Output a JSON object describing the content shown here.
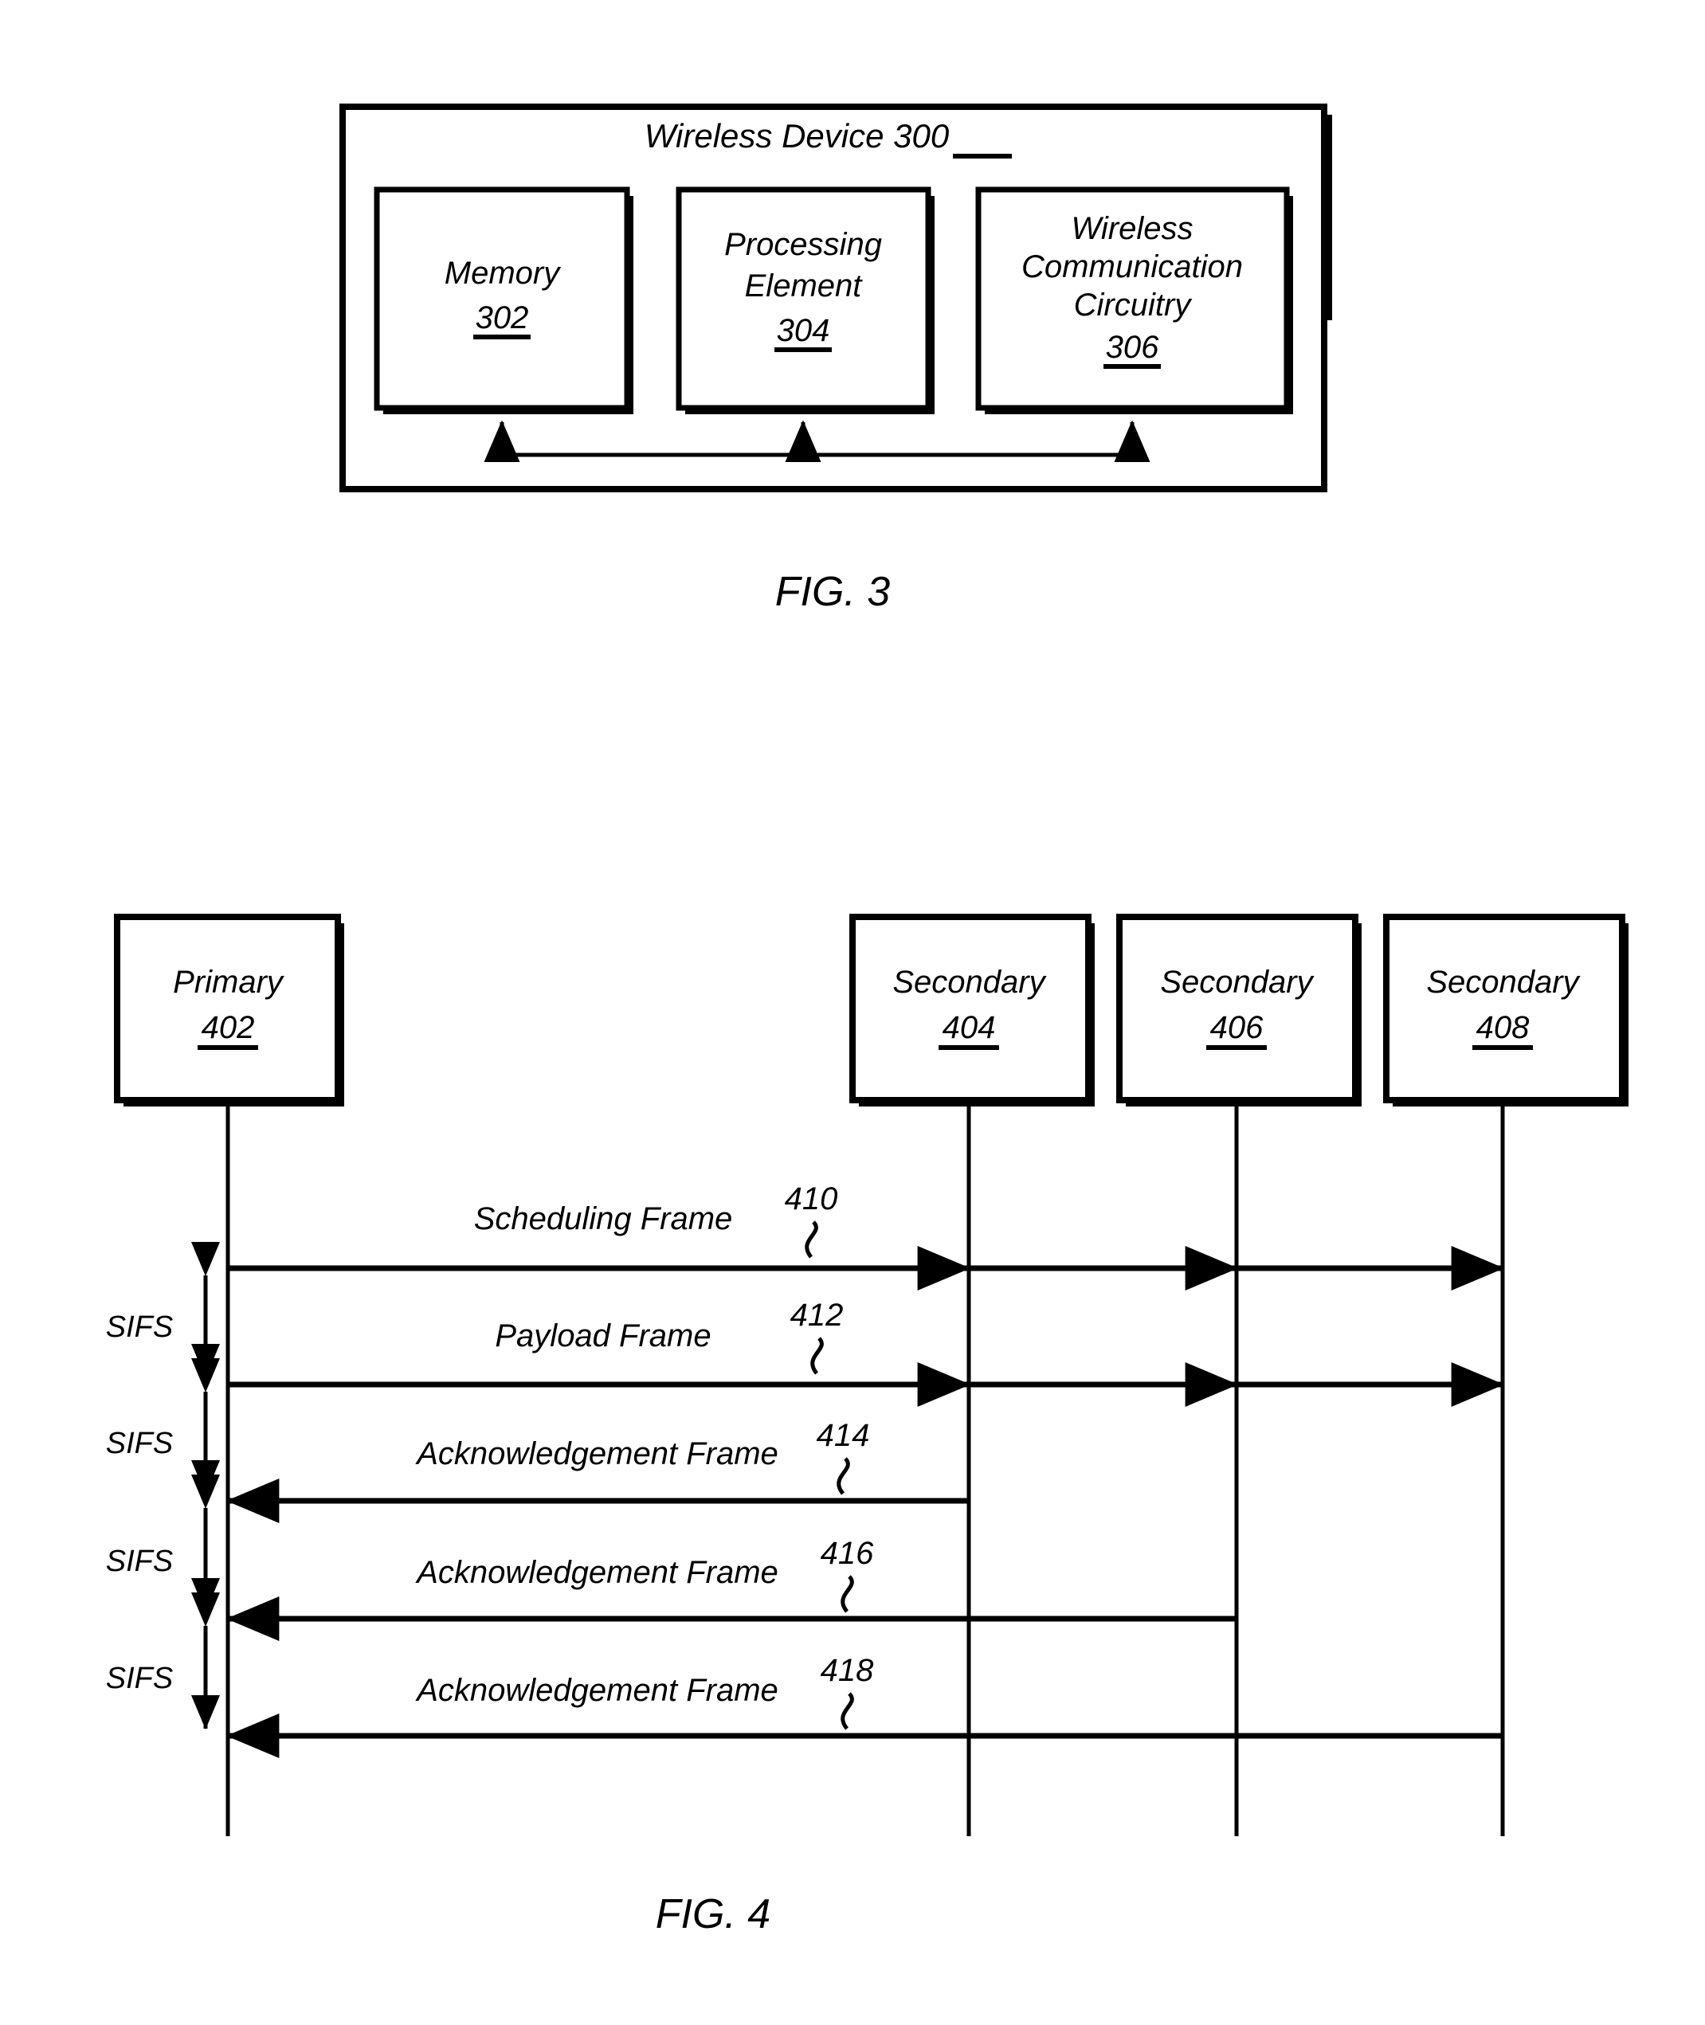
{
  "figure3": {
    "caption": "FIG. 3",
    "device": {
      "title": "Wireless Device",
      "ref": "300"
    },
    "blocks": [
      {
        "name": "Memory",
        "lines": [
          "Memory"
        ],
        "ref": "302"
      },
      {
        "name": "Processing Element",
        "lines": [
          "Processing",
          "Element"
        ],
        "ref": "304"
      },
      {
        "name": "Wireless Communication Circuitry",
        "lines": [
          "Wireless",
          "Communication",
          "Circuitry"
        ],
        "ref": "306"
      }
    ]
  },
  "figure4": {
    "caption": "FIG. 4",
    "nodes": [
      {
        "name": "Primary",
        "ref": "402"
      },
      {
        "name": "Secondary",
        "ref": "404"
      },
      {
        "name": "Secondary",
        "ref": "406"
      },
      {
        "name": "Secondary",
        "ref": "408"
      }
    ],
    "messages": [
      {
        "label": "Scheduling Frame",
        "ref": "410",
        "direction": "downlink-broadcast",
        "from": "Primary",
        "to": [
          "Secondary 404",
          "Secondary 406",
          "Secondary 408"
        ]
      },
      {
        "label": "Payload Frame",
        "ref": "412",
        "direction": "downlink-broadcast",
        "from": "Primary",
        "to": [
          "Secondary 404",
          "Secondary 406",
          "Secondary 408"
        ]
      },
      {
        "label": "Acknowledgement Frame",
        "ref": "414",
        "direction": "uplink",
        "from": "Secondary 404",
        "to": [
          "Primary"
        ]
      },
      {
        "label": "Acknowledgement Frame",
        "ref": "416",
        "direction": "uplink",
        "from": "Secondary 406",
        "to": [
          "Primary"
        ]
      },
      {
        "label": "Acknowledgement Frame",
        "ref": "418",
        "direction": "uplink",
        "from": "Secondary 408",
        "to": [
          "Primary"
        ]
      }
    ],
    "intervals": [
      {
        "label": "SIFS",
        "between": [
          "410",
          "412"
        ]
      },
      {
        "label": "SIFS",
        "between": [
          "412",
          "414"
        ]
      },
      {
        "label": "SIFS",
        "between": [
          "414",
          "416"
        ]
      },
      {
        "label": "SIFS",
        "between": [
          "416",
          "418"
        ]
      }
    ]
  }
}
